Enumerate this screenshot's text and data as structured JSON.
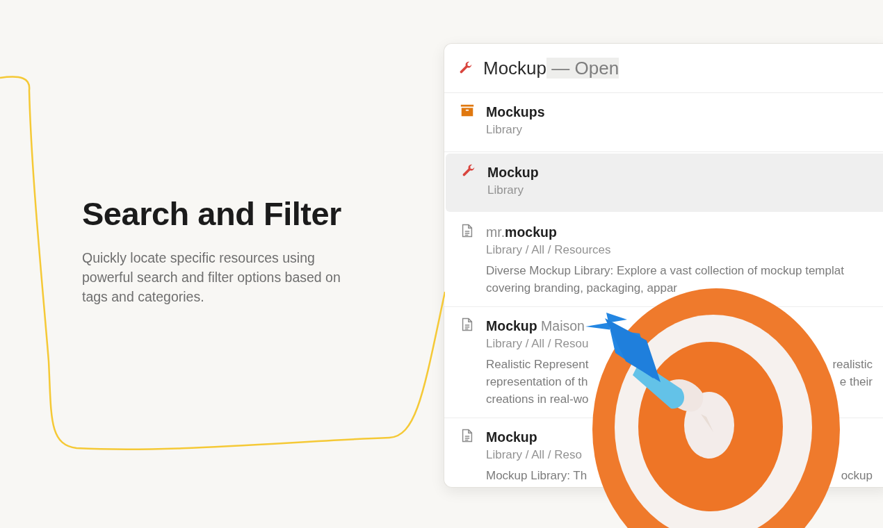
{
  "hero": {
    "title": "Search and Filter",
    "description": "Quickly locate specific resources using powerful search and filter options based on tags and categories."
  },
  "search": {
    "value": "Mockup",
    "suggestion": "— Open",
    "kind": "wrench"
  },
  "results": [
    {
      "kind": "archive",
      "selected": false,
      "title_parts": [
        {
          "text": "Mockups",
          "match": true
        }
      ],
      "path": "Library"
    },
    {
      "kind": "wrench",
      "selected": true,
      "title_parts": [
        {
          "text": "Mockup",
          "match": true
        }
      ],
      "path": "Library"
    },
    {
      "kind": "document",
      "selected": false,
      "title_parts": [
        {
          "text": "mr.",
          "match": false
        },
        {
          "text": "mockup",
          "match": true
        }
      ],
      "path": "Library / All / Resources",
      "lines": [
        {
          "left": "Diverse Mockup Library: Explore a vast collection of mockup templat"
        },
        {
          "left": "covering branding, packaging, appar"
        }
      ]
    },
    {
      "kind": "document",
      "selected": false,
      "title_parts": [
        {
          "text": "Mockup",
          "match": true
        },
        {
          "text": " Maison",
          "match": false
        }
      ],
      "path": "Library / All / Resou",
      "lines": [
        {
          "left": "Realistic Represent",
          "right": "realistic"
        },
        {
          "left": "representation of th",
          "right": "e their"
        },
        {
          "left": "creations in real-wo"
        }
      ]
    },
    {
      "kind": "document",
      "selected": false,
      "title_parts": [
        {
          "text": "Mockup",
          "match": true
        }
      ],
      "path": "Library / All / Reso",
      "lines": [
        {
          "left": "Mockup Library: Th",
          "right": "ockup"
        }
      ]
    }
  ]
}
